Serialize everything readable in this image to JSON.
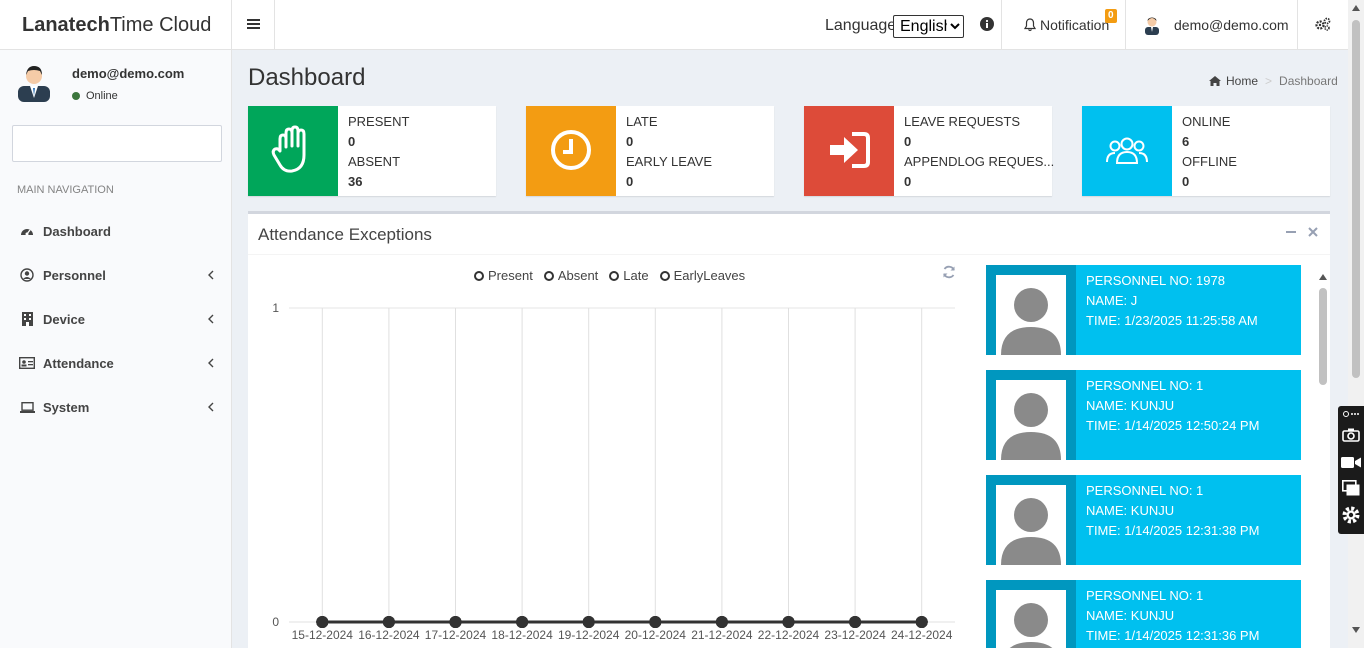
{
  "app": {
    "title_bold": "Lanatech",
    "title_rest": "Time Cloud"
  },
  "header": {
    "language_label": "Language",
    "language_selected": "English",
    "notification_label": "Notification",
    "notification_count": "0",
    "user_email": "demo@demo.com"
  },
  "sidebar": {
    "user_name": "demo@demo.com",
    "status": "Online",
    "search_placeholder": "",
    "nav_header": "MAIN NAVIGATION",
    "items": [
      {
        "label": "Dashboard",
        "icon": "dashboard-icon"
      },
      {
        "label": "Personnel",
        "icon": "user-circle-icon"
      },
      {
        "label": "Device",
        "icon": "building-icon"
      },
      {
        "label": "Attendance",
        "icon": "id-card-icon"
      },
      {
        "label": "System",
        "icon": "laptop-icon"
      }
    ]
  },
  "page": {
    "title": "Dashboard",
    "breadcrumb": {
      "home": "Home",
      "current": "Dashboard"
    }
  },
  "info_boxes": [
    {
      "color": "#00a65a",
      "icon": "hand-icon",
      "label1": "PRESENT",
      "value1": "0",
      "label2": "ABSENT",
      "value2": "36"
    },
    {
      "color": "#f39c12",
      "icon": "clock-icon",
      "label1": "LATE",
      "value1": "0",
      "label2": "EARLY LEAVE",
      "value2": "0"
    },
    {
      "color": "#dd4b39",
      "icon": "sign-in-icon",
      "label1": "LEAVE REQUESTS",
      "value1": "0",
      "label2": "APPENDLOG REQUES...",
      "value2": "0"
    },
    {
      "color": "#00c0ef",
      "icon": "users-icon",
      "label1": "ONLINE",
      "value1": "6",
      "label2": "OFFLINE",
      "value2": "0"
    }
  ],
  "attendance": {
    "title": "Attendance Exceptions",
    "legend": [
      "Present",
      "Absent",
      "Late",
      "EarlyLeaves"
    ]
  },
  "chart_data": {
    "type": "line",
    "x": [
      "15-12-2024",
      "16-12-2024",
      "17-12-2024",
      "18-12-2024",
      "19-12-2024",
      "20-12-2024",
      "21-12-2024",
      "22-12-2024",
      "23-12-2024",
      "24-12-2024"
    ],
    "series": [
      {
        "name": "Present",
        "values": [
          0,
          0,
          0,
          0,
          0,
          0,
          0,
          0,
          0,
          0
        ]
      },
      {
        "name": "Absent",
        "values": [
          0,
          0,
          0,
          0,
          0,
          0,
          0,
          0,
          0,
          0
        ]
      },
      {
        "name": "Late",
        "values": [
          0,
          0,
          0,
          0,
          0,
          0,
          0,
          0,
          0,
          0
        ]
      },
      {
        "name": "EarlyLeaves",
        "values": [
          0,
          0,
          0,
          0,
          0,
          0,
          0,
          0,
          0,
          0
        ]
      }
    ],
    "ylim": [
      0,
      1
    ],
    "yticks": [
      "0",
      "1"
    ],
    "grid": "vertical",
    "legend": "top-center",
    "color": "#333333"
  },
  "feed": [
    {
      "no": "PERSONNEL NO: 1978",
      "name": "NAME: J",
      "time": "TIME: 1/23/2025 11:25:58 AM"
    },
    {
      "no": "PERSONNEL NO: 1",
      "name": "NAME: KUNJU",
      "time": "TIME: 1/14/2025 12:50:24 PM"
    },
    {
      "no": "PERSONNEL NO: 1",
      "name": "NAME: KUNJU",
      "time": "TIME: 1/14/2025 12:31:38 PM"
    },
    {
      "no": "PERSONNEL NO: 1",
      "name": "NAME: KUNJU",
      "time": "TIME: 1/14/2025 12:31:36 PM"
    }
  ]
}
